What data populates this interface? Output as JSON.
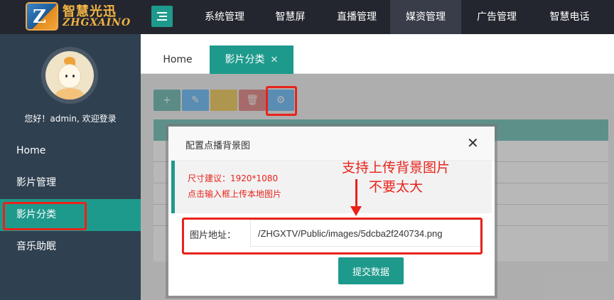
{
  "brand": {
    "name_cn": "智慧光迅",
    "name_en": "ZHGXAINO",
    "mark": "Z"
  },
  "nav": {
    "items": [
      {
        "label": "系统管理"
      },
      {
        "label": "智慧屏"
      },
      {
        "label": "直播管理"
      },
      {
        "label": "媒资管理"
      },
      {
        "label": "广告管理"
      },
      {
        "label": "智慧电话"
      }
    ],
    "active": "媒资管理"
  },
  "sidebar": {
    "welcome": "您好！admin, 欢迎登录",
    "items": [
      {
        "label": "Home"
      },
      {
        "label": "影片管理"
      },
      {
        "label": "影片分类"
      },
      {
        "label": "音乐助眠"
      }
    ],
    "active": "影片分类"
  },
  "tabs": {
    "home": "Home",
    "active": "影片分类",
    "close_glyph": "✕"
  },
  "toolbar": {
    "add_glyph": "+",
    "edit_glyph": "✎",
    "delete_glyph": "🗑",
    "settings_glyph": "⚙"
  },
  "dialog": {
    "title": "配置点播背景图",
    "close_glyph": "✕",
    "notice_size": "尺寸建议：1920*1080",
    "notice_hint": "点击输入框上传本地图片",
    "field_label": "图片地址：",
    "field_value": "/ZHGXTV/Public/images/5dcba2f240734.png",
    "submit_label": "提交数据"
  },
  "annotation": {
    "line1": "支持上传背景图片",
    "line2": "不要太大"
  },
  "colors": {
    "topbar": "#23262e",
    "sidebar": "#2f4050",
    "accent": "#1e9a8c",
    "highlight_red": "#e8231c",
    "logo_gold": "#f3b343"
  }
}
